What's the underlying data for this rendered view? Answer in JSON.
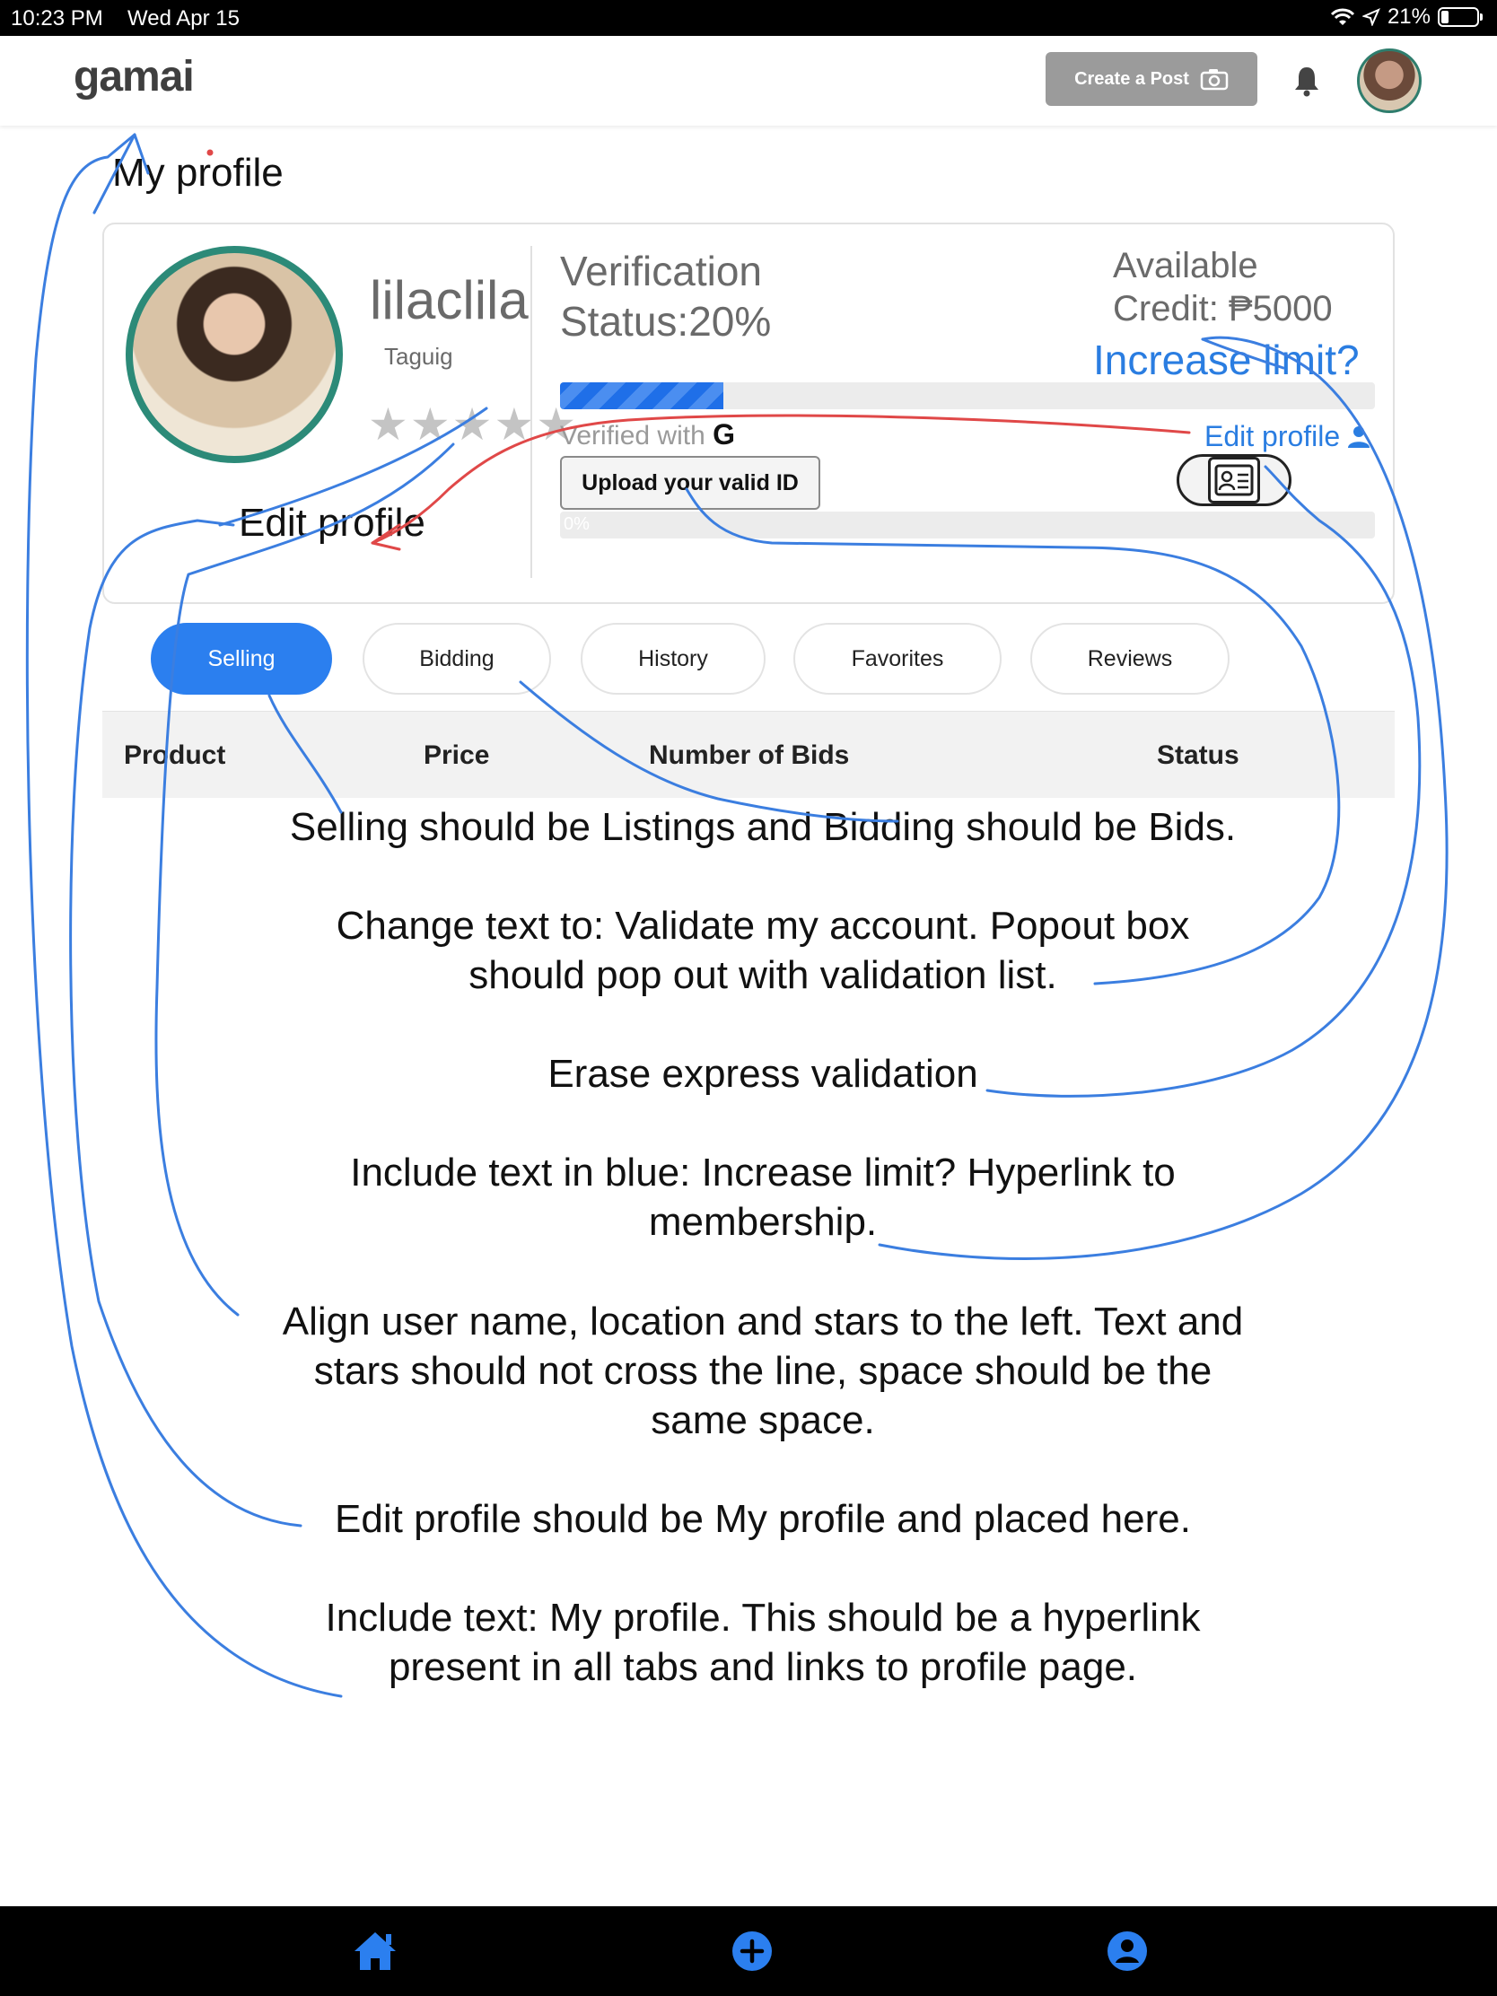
{
  "status_bar": {
    "time": "10:23 PM",
    "date": "Wed Apr 15",
    "battery": "21%"
  },
  "header": {
    "logo": "gamai",
    "create_post_label": "Create a Post",
    "icons": {
      "camera": "camera-icon",
      "notifications": "bell-icon",
      "avatar": "avatar"
    }
  },
  "page": {
    "title": "My profile"
  },
  "profile": {
    "username": "lilaclila",
    "location": "Taguig",
    "stars": "★★★★★",
    "rating_filled": 0,
    "edit_profile_label": "Edit profile"
  },
  "verification": {
    "title_line1": "Verification",
    "title_line2": "Status:20%",
    "progress_fraction": 0.2,
    "verified_with_label": "Verified with",
    "verified_with_provider": "G",
    "upload_button": "Upload your valid ID",
    "second_progress_label": "0%",
    "second_progress_fraction": 0
  },
  "credit": {
    "line1": "Available",
    "line2": "Credit: ₱5000",
    "increase_limit_label": "Increase limit?",
    "edit_profile_label": "Edit profile"
  },
  "tabs": [
    {
      "label": "Selling",
      "active": true
    },
    {
      "label": "Bidding",
      "active": false
    },
    {
      "label": "History",
      "active": false
    },
    {
      "label": "Favorites",
      "active": false
    },
    {
      "label": "Reviews",
      "active": false
    }
  ],
  "table": {
    "columns": [
      "Product",
      "Price",
      "Number of Bids",
      "Status"
    ]
  },
  "notes": [
    {
      "lines": [
        "Selling should be Listings and Bidding should be Bids."
      ]
    },
    {
      "lines": [
        "Change text to: Validate my account. Popout box",
        "should pop out with validation list."
      ]
    },
    {
      "lines": [
        "Erase express validation"
      ]
    },
    {
      "lines": [
        "Include text in blue: Increase limit? Hyperlink to",
        "membership."
      ]
    },
    {
      "lines": [
        "Align user name, location and stars to the left. Text and",
        "stars should not cross the line, space should be the",
        "same space."
      ]
    },
    {
      "lines": [
        "Edit profile should be My profile and placed here."
      ]
    },
    {
      "lines": [
        "Include text: My profile. This should be a hyperlink",
        "present in all tabs and links to profile page."
      ]
    }
  ],
  "colors": {
    "accent_blue": "#2b7fef",
    "link_blue": "#2a7de1",
    "annotation_blue": "#3b7ee0",
    "annotation_red": "#e04848",
    "avatar_ring": "#2c8a78"
  },
  "bottom_nav": {
    "icons": [
      "home-icon",
      "add-icon",
      "account-icon"
    ]
  }
}
